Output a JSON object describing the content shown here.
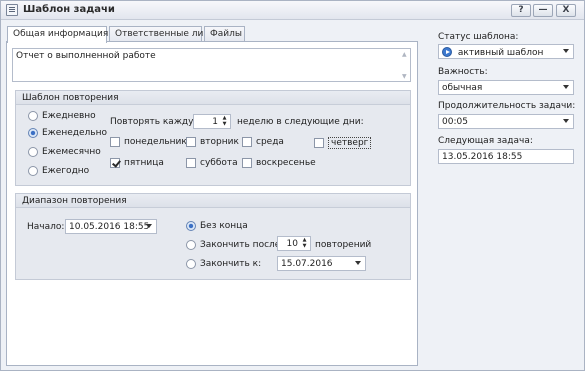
{
  "window": {
    "title": "Шаблон задачи",
    "buttons": {
      "help": "?",
      "minimize": "—",
      "close": "X"
    }
  },
  "tabs": [
    {
      "label": "Общая информация",
      "active": true
    },
    {
      "label": "Ответственные лица",
      "active": false
    },
    {
      "label": "Файлы",
      "active": false
    }
  ],
  "subject": "Отчет о выполненной работе",
  "recurrence": {
    "header": "Шаблон повторения",
    "options": [
      {
        "label": "Ежедневно",
        "selected": false
      },
      {
        "label": "Еженедельно",
        "selected": true
      },
      {
        "label": "Ежемесячно",
        "selected": false
      },
      {
        "label": "Ежегодно",
        "selected": false
      }
    ],
    "repeat_every_label": "Повторять каждую",
    "repeat_every_value": "1",
    "repeat_suffix": "неделю в следующие дни:",
    "days": [
      {
        "label": "понедельник",
        "checked": false
      },
      {
        "label": "вторник",
        "checked": false
      },
      {
        "label": "среда",
        "checked": false
      },
      {
        "label": "четверг",
        "checked": false
      },
      {
        "label": "пятница",
        "checked": true
      },
      {
        "label": "суббота",
        "checked": false
      },
      {
        "label": "воскресенье",
        "checked": false
      }
    ]
  },
  "range": {
    "header": "Диапазон повторения",
    "start_label": "Начало:",
    "start_value": "10.05.2016 18:55",
    "no_end_label": "Без конца",
    "end_after_label": "Закончить после:",
    "end_after_value": "10",
    "occurrences_label": "повторений",
    "end_by_label": "Закончить к:",
    "end_by_value": "15.07.2016"
  },
  "side": {
    "status_label": "Статус шаблона:",
    "status_value": "активный шаблон",
    "importance_label": "Важность:",
    "importance_value": "обычная",
    "duration_label": "Продолжительность задачи:",
    "duration_value": "00:05",
    "next_label": "Следующая задача:",
    "next_value": "13.05.2016 18:55"
  },
  "colors": {
    "accent": "#3d79cf",
    "panel": "#eef1f6",
    "group": "#e6e9ef"
  }
}
